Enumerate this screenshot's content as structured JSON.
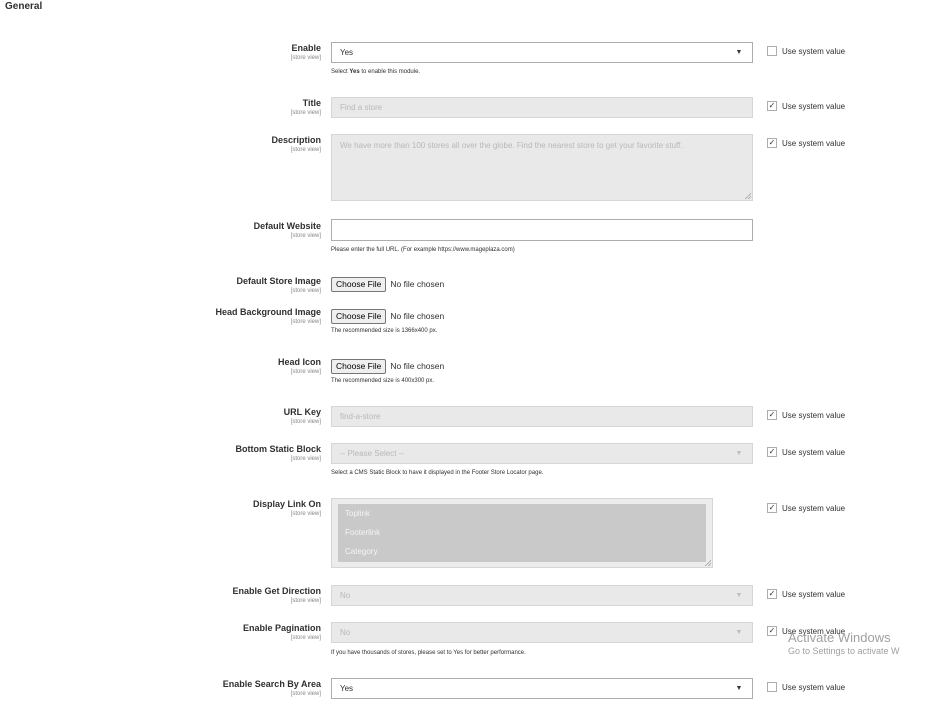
{
  "section_title": "General",
  "system_value_label": "Use system value",
  "scope_label": "[store view]",
  "choose_file_label": "Choose File",
  "no_file_label": "No file chosen",
  "fields": {
    "enable": {
      "label": "Enable",
      "value": "Yes",
      "note_prefix": "Select ",
      "note_bold": "Yes",
      "note_suffix": " to enable this module.",
      "use_system": false
    },
    "title": {
      "label": "Title",
      "placeholder": "Find a store",
      "use_system": true
    },
    "description": {
      "label": "Description",
      "value": "We have more than 100 stores all over the globe. Find the nearest store to get your favorite stuff.",
      "use_system": true
    },
    "default_website": {
      "label": "Default Website",
      "value": "",
      "note": "Please enter the full URL. (For example https://www.mageplaza.com)"
    },
    "default_store_image": {
      "label": "Default Store Image"
    },
    "head_background_image": {
      "label": "Head Background Image",
      "note": "The recommended size is 1366x400 px."
    },
    "head_icon": {
      "label": "Head Icon",
      "note": "The recommended size is 400x300 px."
    },
    "url_key": {
      "label": "URL Key",
      "placeholder": "find-a-store",
      "use_system": true
    },
    "bottom_static_block": {
      "label": "Bottom Static Block",
      "value": "-- Please Select --",
      "note": "Select a CMS Static Block to have it displayed in the Footer Store Locator page.",
      "use_system": true
    },
    "display_link_on": {
      "label": "Display Link On",
      "options": [
        "Toplink",
        "Footerlink",
        "Category"
      ],
      "use_system": true
    },
    "enable_get_direction": {
      "label": "Enable Get Direction",
      "value": "No",
      "use_system": true
    },
    "enable_pagination": {
      "label": "Enable Pagination",
      "value": "No",
      "note": "If you have thousands of stores, please set to Yes for better performance.",
      "use_system": true
    },
    "enable_search_by_area": {
      "label": "Enable Search By Area",
      "value": "Yes",
      "use_system": false
    }
  },
  "watermark": {
    "line1": "Activate Windows",
    "line2": "Go to Settings to activate W"
  },
  "icons": {
    "checkbox_checked": "✓",
    "dropdown_arrow": "▼"
  }
}
